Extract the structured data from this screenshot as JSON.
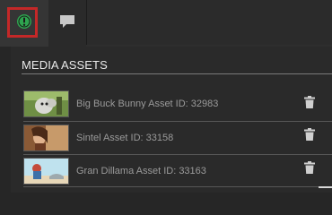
{
  "section": {
    "title": "MEDIA ASSETS"
  },
  "tabs": [
    {
      "icon": "info-icon",
      "selected": true
    },
    {
      "icon": "chat-bubble-icon",
      "selected": false
    }
  ],
  "colors": {
    "accent_green": "#2ea44f",
    "highlight_red": "#c42828"
  },
  "assets": [
    {
      "label": "Big Buck Bunny Asset ID: 32983",
      "thumbnail": "bunny-thumbnail"
    },
    {
      "label": "Sintel Asset ID: 33158",
      "thumbnail": "sintel-thumbnail"
    },
    {
      "label": "Gran Dillama Asset ID: 33163",
      "thumbnail": "gran-dillama-thumbnail"
    }
  ]
}
